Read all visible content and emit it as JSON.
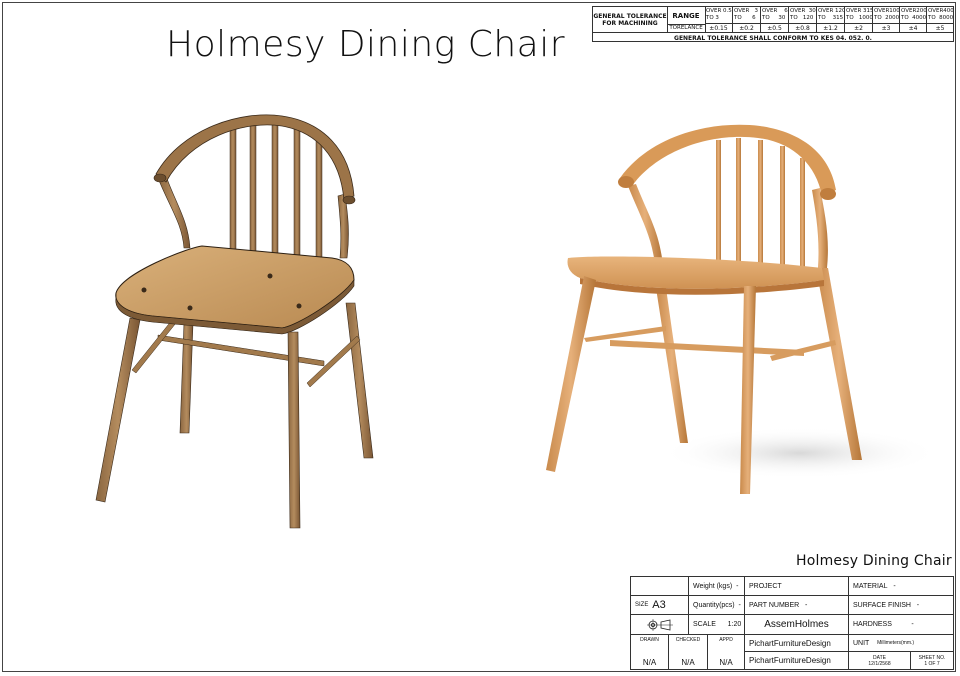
{
  "title": "Holmesy Dining Chair",
  "tolerance_table": {
    "label": "GENERAL TOLERANCE FOR MACHINING",
    "range_header": "RANGE",
    "tolerance_header": "TORELANCE",
    "ranges": [
      "OVER 0.5\nTO 3",
      "OVER   3\nTO      6",
      "OVER    6\nTO     30",
      "OVER  30\nTO   120",
      "OVER 120\nTO    315",
      "OVER 315\nTO   1000",
      "OVER1000\nTO  2000",
      "OVER2000\nTO  4000",
      "OVER4000\nTO  8000"
    ],
    "tolerances": [
      "±0.15",
      "±0.2",
      "±0.5",
      "±0.8",
      "±1.2",
      "±2",
      "±3",
      "±4",
      "±5"
    ],
    "note": "GENERAL TOLERANCE SHALL CONFORM TO KES 04. 052. 0."
  },
  "title_block": {
    "heading": "Holmesy Dining Chair",
    "weight_label": "Weight (kgs)",
    "weight_value": "-",
    "project_label": "PROJECT",
    "material_label": "MATERIAL",
    "material_value": "-",
    "size_label": "SIZE",
    "size_value": "A3",
    "quantity_label": "Quantity(pcs)",
    "quantity_value": "-",
    "part_number_label": "PART NUMBER",
    "part_number_value": "-",
    "surface_finish_label": "SURFACE FINISH",
    "surface_finish_value": "-",
    "scale_label": "SCALE",
    "scale_value": "1:20",
    "designer": "AssemHolmes",
    "hardness_label": "HARDNESS",
    "hardness_value": "-",
    "drawn_label": "DRAWN",
    "checked_label": "CHECKED",
    "appd_label": "APPD",
    "drawn_value": "N/A",
    "checked_value": "N/A",
    "appd_value": "N/A",
    "company_1": "PichartFurnitureDesign",
    "company_2": "PichartFurnitureDesign",
    "unit_label": "UNIT",
    "unit_value": "Millimeters(mm.)",
    "date_label": "DATE",
    "date_value": "12/1/2568",
    "sheet_label": "SHEET NO.",
    "sheet_value": "1 OF 7"
  }
}
